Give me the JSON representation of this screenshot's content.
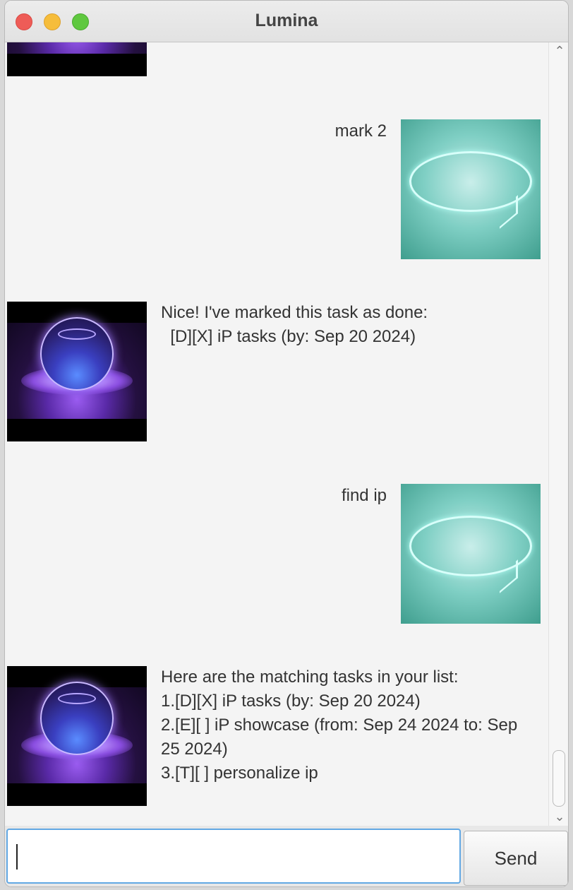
{
  "window": {
    "title": "Lumina"
  },
  "conversation": [
    {
      "sender": "user",
      "text": "mark 2"
    },
    {
      "sender": "bot",
      "text": "Nice! I've marked this task as done:\n  [D][X] iP tasks (by: Sep 20 2024)"
    },
    {
      "sender": "user",
      "text": "find ip"
    },
    {
      "sender": "bot",
      "text": "Here are the matching tasks in your list:\n1.[D][X] iP tasks (by: Sep 20 2024)\n2.[E][ ] iP showcase (from: Sep 24 2024 to: Sep\n25 2024)\n3.[T][ ] personalize ip"
    }
  ],
  "input": {
    "value": "",
    "placeholder": ""
  },
  "send_button": {
    "label": "Send"
  },
  "icons": {
    "bot_avatar": "glowing-orb-avatar",
    "user_avatar": "speech-bubble-avatar",
    "scroll_up": "chevron-up-icon",
    "scroll_down": "chevron-down-icon"
  },
  "colors": {
    "input_focus_border": "#62a8e3",
    "traffic_close": "#ee5c57",
    "traffic_minimize": "#f6bd3b",
    "traffic_maximize": "#5fc83f"
  }
}
